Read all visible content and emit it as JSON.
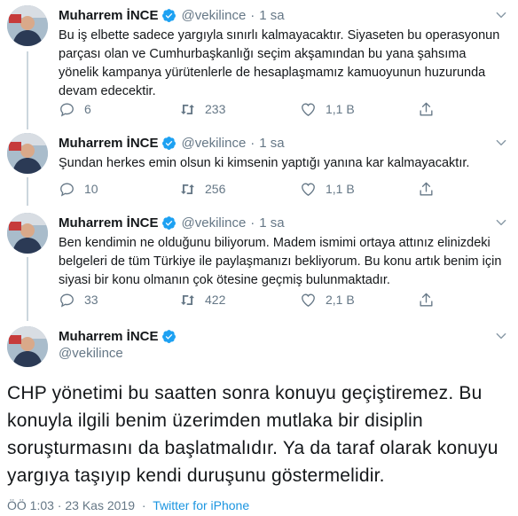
{
  "author": {
    "name": "Muharrem İNCE",
    "handle": "@vekilince",
    "verified": true
  },
  "colors": {
    "accent": "#1da1f2",
    "secondary_text": "#657786",
    "link": "#1b95e0"
  },
  "thread": [
    {
      "time": "1 sa",
      "text": "Bu iş elbette sadece yargıyla sınırlı kalmayacaktır. Siyaseten bu operasyonun parçası olan ve Cumhurbaşkanlığı seçim akşamından bu yana şahsıma yönelik kampanya yürütenlerle de hesaplaşmamız kamuoyunun huzurunda devam edecektir.",
      "replies": "6",
      "retweets": "233",
      "likes": "1,1 B"
    },
    {
      "time": "1 sa",
      "text": "Şundan herkes emin olsun ki kimsenin yaptığı yanına kar kalmayacaktır.",
      "replies": "10",
      "retweets": "256",
      "likes": "1,1 B"
    },
    {
      "time": "1 sa",
      "text": "Ben kendimin ne olduğunu biliyorum. Madem ismimi ortaya attınız elinizdeki belgeleri de tüm Türkiye ile paylaşmanızı bekliyorum.  Bu konu artık benim için siyasi bir konu olmanın çok ötesine geçmiş bulunmaktadır.",
      "replies": "33",
      "retweets": "422",
      "likes": "2,1 B"
    }
  ],
  "main_tweet": {
    "text": "CHP yönetimi bu saatten sonra konuyu geçiştiremez. Bu konuyla ilgili benim üzerimden mutlaka bir disiplin soruşturmasını da başlatmalıdır. Ya da  taraf olarak konuyu yargıya taşıyıp kendi duruşunu göstermelidir.",
    "timestamp": "ÖÖ 1:03 · 23 Kas 2019",
    "separator": "·",
    "source": "Twitter for iPhone"
  },
  "icons": {
    "reply": "reply-icon",
    "retweet": "retweet-icon",
    "like": "heart-icon",
    "share": "share-icon",
    "menu": "chevron-down-icon",
    "verified": "verified-badge-icon"
  }
}
